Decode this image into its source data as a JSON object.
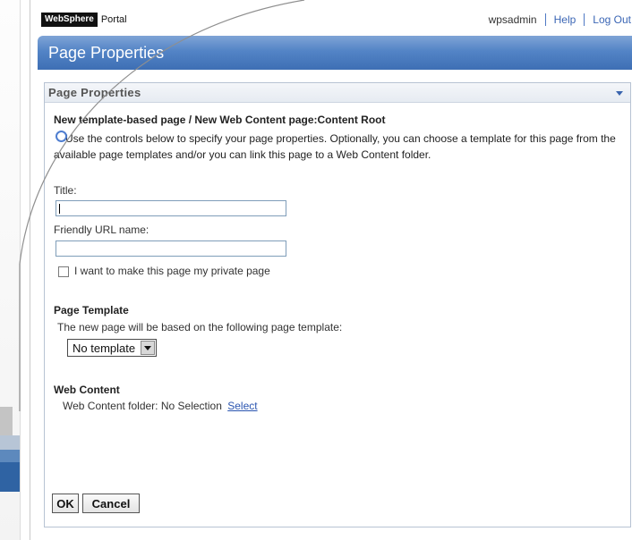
{
  "header": {
    "brand_primary": "WebSphere",
    "brand_secondary": "Portal",
    "user": "wpsadmin",
    "help_label": "Help",
    "logout_label": "Log Out"
  },
  "page": {
    "title": "Page Properties"
  },
  "portlet": {
    "title": "Page Properties",
    "breadcrumb": "New template-based page / New Web Content page:Content Root",
    "info_text": "Use the controls below to specify your page properties. Optionally, you can choose a template for this page from the available page templates and/or you can link this page to a Web Content folder.",
    "title_label": "Title:",
    "title_value": "",
    "friendly_url_label": "Friendly URL name:",
    "friendly_url_value": "",
    "private_checkbox_label": "I want to make this page my private page",
    "private_checked": false,
    "template_section_title": "Page Template",
    "template_desc": "The new page will be based on the following page template:",
    "template_selected": "No template",
    "web_content_section_title": "Web Content",
    "web_content_folder_text": "Web Content folder: No Selection",
    "select_link_label": "Select",
    "ok_label": "OK",
    "cancel_label": "Cancel"
  },
  "colors": {
    "titlebar": "#5384c6",
    "link": "#3b66b5",
    "portlet_border": "#b7c3d3"
  }
}
